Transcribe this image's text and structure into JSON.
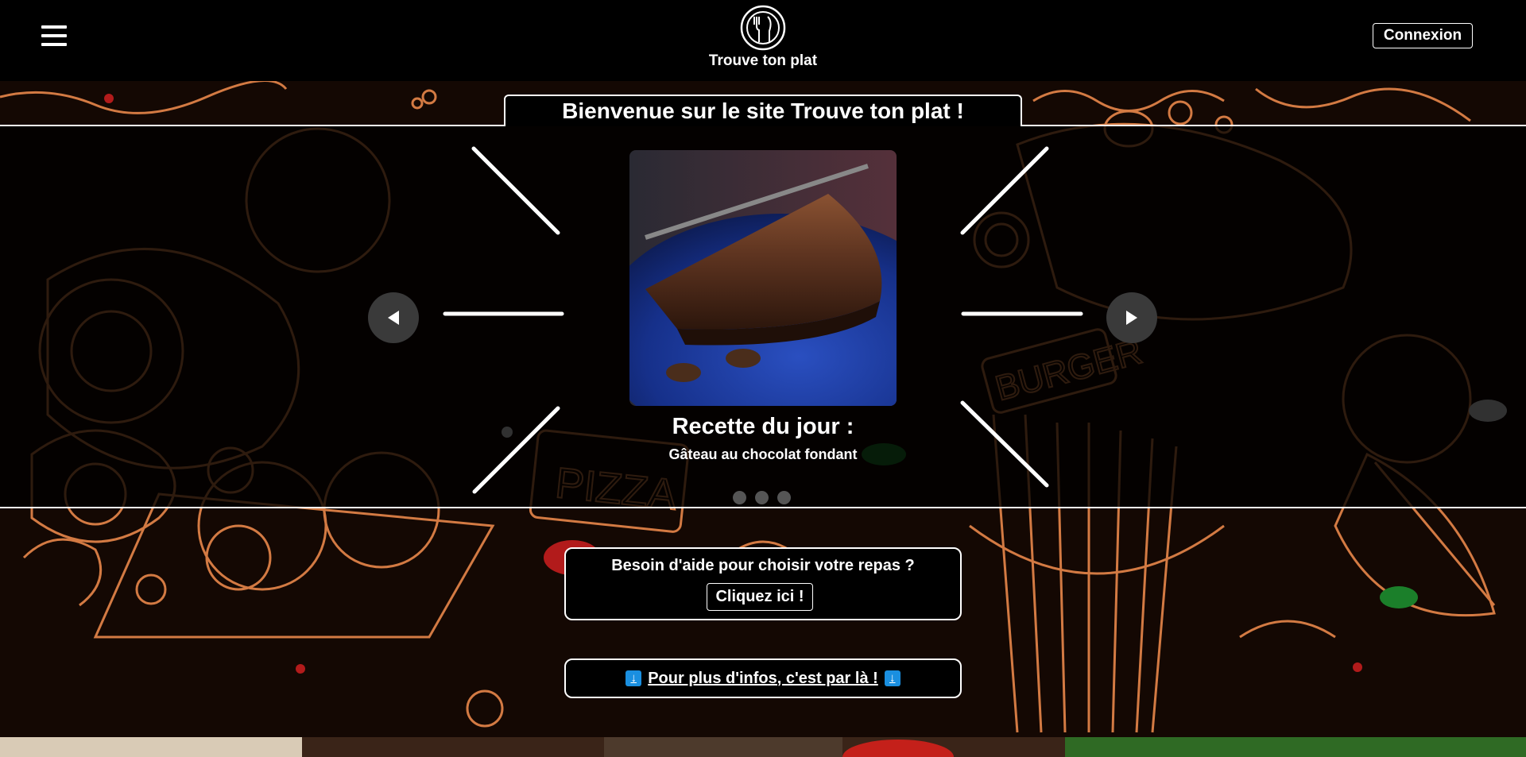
{
  "header": {
    "brand_name": "Trouve ton plat",
    "login_label": "Connexion",
    "menu_icon": "hamburger-menu-icon",
    "logo_icon": "fork-knife-logo-icon"
  },
  "welcome": {
    "title": "Bienvenue sur le site Trouve ton plat !"
  },
  "carousel": {
    "title": "Recette du jour :",
    "dish_name": "Gâteau au chocolat fondant",
    "prev_icon": "arrow-left-icon",
    "next_icon": "arrow-right-icon",
    "slides_count": 3,
    "active_slide": 1
  },
  "help": {
    "question": "Besoin d'aide pour choisir votre repas ?",
    "button_label": "Cliquez ici !"
  },
  "info": {
    "link_text": "Pour plus d'infos, c'est par là !",
    "emoji_icon": "arrow-down-emoji-icon"
  },
  "colors": {
    "doodle": "#e8874a",
    "background": "#140803",
    "header": "#000000"
  }
}
